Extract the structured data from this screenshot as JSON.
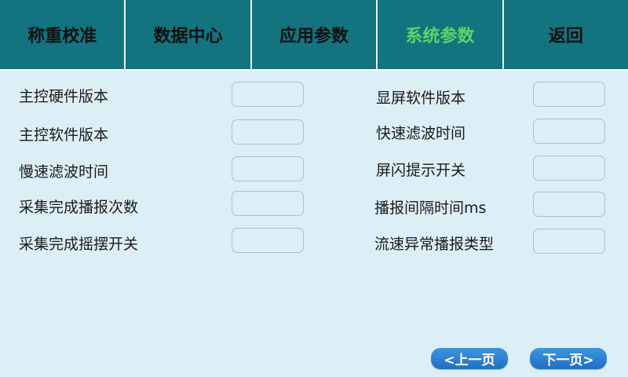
{
  "tabs": [
    {
      "label": "称重校准",
      "active": false
    },
    {
      "label": "数据中心",
      "active": false
    },
    {
      "label": "应用参数",
      "active": false
    },
    {
      "label": "系统参数",
      "active": true
    },
    {
      "label": "返回",
      "active": false
    }
  ],
  "left_params": [
    {
      "label": "主控硬件版本",
      "value": ""
    },
    {
      "label": "主控软件版本",
      "value": ""
    },
    {
      "label": "慢速滤波时间",
      "value": ""
    },
    {
      "label": "采集完成播报次数",
      "value": ""
    },
    {
      "label": "采集完成摇摆开关",
      "value": ""
    }
  ],
  "right_params": [
    {
      "label": "显屏软件版本",
      "value": ""
    },
    {
      "label": "快速滤波时间",
      "value": ""
    },
    {
      "label": "屏闪提示开关",
      "value": ""
    },
    {
      "label": "播报间隔时间ms",
      "value": ""
    },
    {
      "label": "流速异常播报类型",
      "value": ""
    }
  ],
  "pager": {
    "prev_label": "<上一页",
    "next_label": "下一页>"
  },
  "colors": {
    "header_bg": "#13737f",
    "active_tab": "#5fd36a",
    "panel_bg": "#ddeff6",
    "button_blue": "#2a7fd4"
  }
}
